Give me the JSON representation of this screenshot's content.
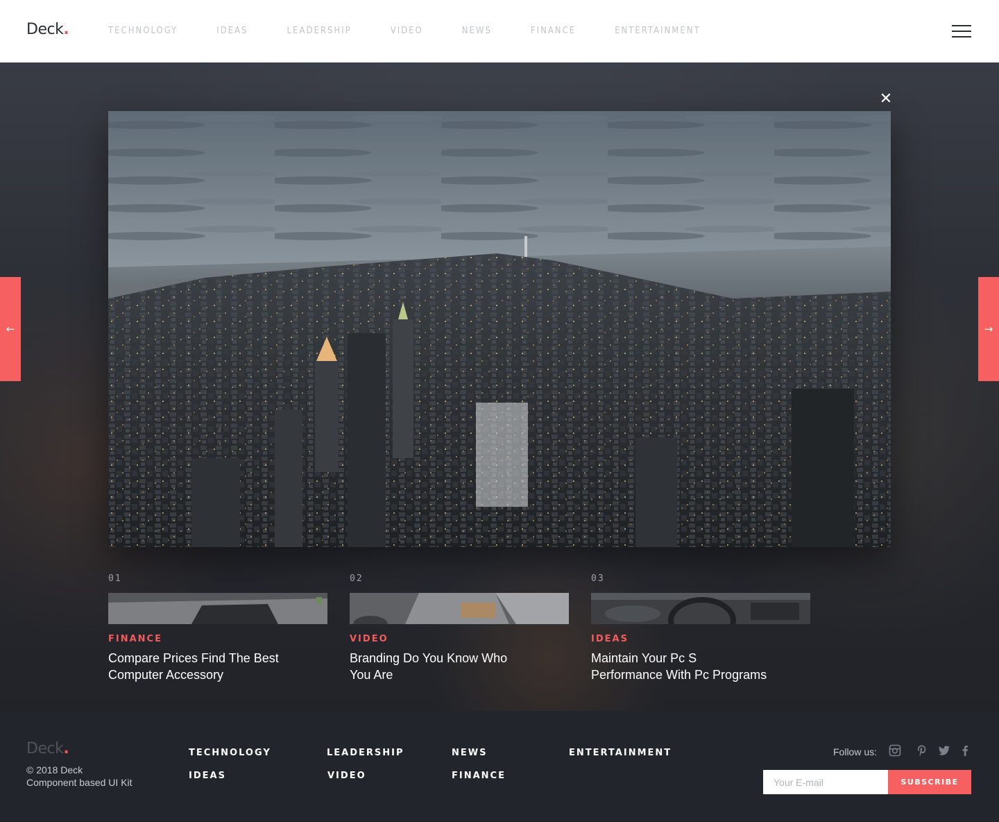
{
  "header": {
    "logo_text": "Deck",
    "logo_dot": ".",
    "nav": [
      "TECHNOLOGY",
      "IDEAS",
      "LEADERSHIP",
      "VIDEO",
      "NEWS",
      "FINANCE",
      "ENTERTAINMENT"
    ]
  },
  "lightbox": {
    "close_glyph": "✕",
    "prev_glyph": "←",
    "next_glyph": "→",
    "cards": [
      {
        "number": "01",
        "category": "FINANCE",
        "title": "Compare Prices Find The Best Computer Accessory"
      },
      {
        "number": "02",
        "category": "VIDEO",
        "title": "Branding Do You Know Who You Are"
      },
      {
        "number": "03",
        "category": "IDEAS",
        "title": "Maintain Your Pc S Performance With Pc Programs"
      }
    ]
  },
  "footer": {
    "logo_text": "Deck",
    "logo_dot": ".",
    "copyright": "© 2018 Deck",
    "tagline": "Component based UI Kit",
    "links": {
      "technology": "TECHNOLOGY",
      "ideas": "IDEAS",
      "leadership": "LEADERSHIP",
      "video": "VIDEO",
      "news": "NEWS",
      "finance": "FINANCE",
      "entertainment": "ENTERTAINMENT"
    },
    "follow_label": "Follow us:",
    "social_icons": [
      "instagram-icon",
      "pinterest-icon",
      "twitter-icon",
      "facebook-icon"
    ],
    "email_placeholder": "Your E-mail",
    "subscribe_label": "SUBSCRIBE"
  },
  "colors": {
    "accent": "#f76060",
    "category": "#f25c5c",
    "footer_bg": "#22252b",
    "header_bg": "#ffffff",
    "nav_text": "#c2c5cb"
  }
}
